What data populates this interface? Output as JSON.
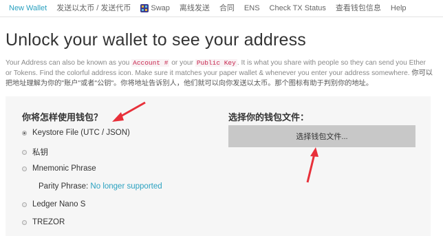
{
  "nav": {
    "tabs": [
      {
        "label": "New Wallet"
      },
      {
        "label": "发送以太币 / 发送代币"
      },
      {
        "label": "Swap"
      },
      {
        "label": "离线发送"
      },
      {
        "label": "合同"
      },
      {
        "label": "ENS"
      },
      {
        "label": "Check TX Status"
      },
      {
        "label": "查看钱包信息"
      },
      {
        "label": "Help"
      }
    ]
  },
  "page": {
    "title": "Unlock your wallet to see your address",
    "desc_1": "Your Address can also be known as you ",
    "account_code": "Account #",
    "desc_2": " or your ",
    "public_code": "Public Key",
    "desc_3": ". It is what you share with people so they can send you Ether or Tokens. Find the colorful address icon. Make sure it matches your paper wallet & whenever you enter your address somewhere. ",
    "desc_cn": "你可以把地址理解为你的\"账户\"或者\"公钥\"。你将地址告诉别人，他们就可以向你发送以太币。那个图标有助于判别你的地址。"
  },
  "unlock": {
    "heading": "你将怎样使用钱包？",
    "options": [
      {
        "label": "Keystore File (UTC / JSON)",
        "selected": true
      },
      {
        "label": "私钥",
        "selected": false
      },
      {
        "label": "Mnemonic Phrase",
        "selected": false
      },
      {
        "label": "Ledger Nano S",
        "selected": false
      },
      {
        "label": "TREZOR",
        "selected": false
      }
    ],
    "parity_label": "Parity Phrase: ",
    "parity_link": "No longer supported"
  },
  "file": {
    "heading": "选择你的钱包文件：",
    "button_label": "选择钱包文件..."
  },
  "colors": {
    "accent": "#2aa1c0",
    "annotation_arrow": "#e8303a"
  }
}
